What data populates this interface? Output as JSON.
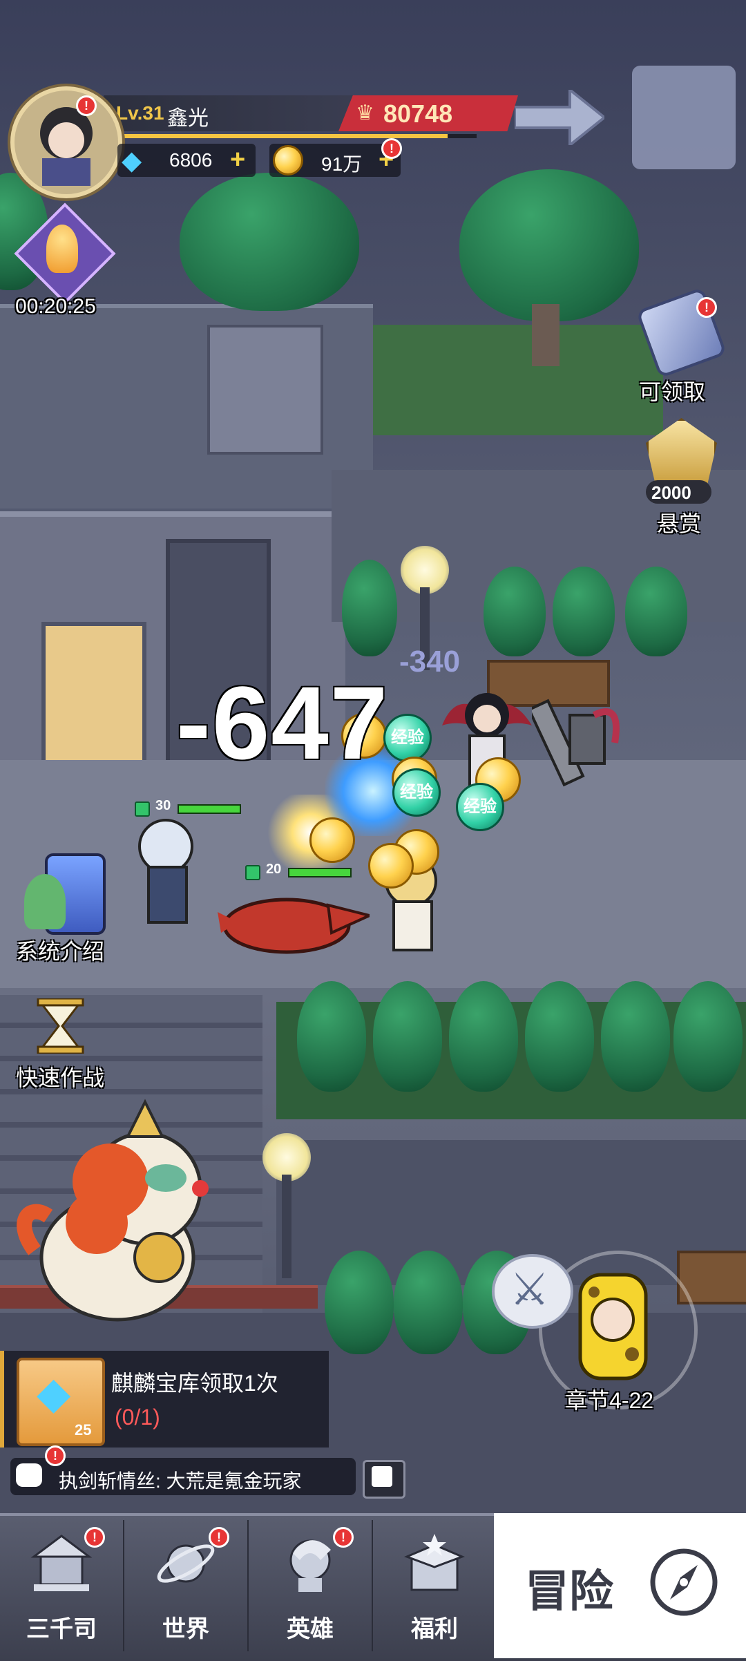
{
  "player": {
    "level": "Lv.31",
    "name": "鑫光",
    "power": "80748"
  },
  "currency": {
    "diamonds": "6806",
    "gold": "91万"
  },
  "timer": "00:20:25",
  "right_panel": {
    "claim_label": "可领取",
    "bounty_value": "2000",
    "bounty_label": "悬赏"
  },
  "battle": {
    "damage_big": "-647",
    "damage_small": "-340",
    "exp_label": "经验",
    "unit_levels": [
      "30",
      "20"
    ]
  },
  "left_menu": {
    "system_intro": "系统介绍",
    "quick_battle": "快速作战"
  },
  "quest": {
    "title": "麒麟宝库领取1次",
    "progress": "(0/1)",
    "reward_count": "25"
  },
  "chapter": "章节4-22",
  "chat": {
    "message": "执剑斩情丝: 大荒是氪金玩家"
  },
  "nav": {
    "items": [
      "三千司",
      "世界",
      "英雄",
      "福利"
    ],
    "adventure": "冒险"
  },
  "colors": {
    "accent_red": "#d8313f",
    "gold": "#f0c64a",
    "nav_bg": "#4a4d5e"
  }
}
